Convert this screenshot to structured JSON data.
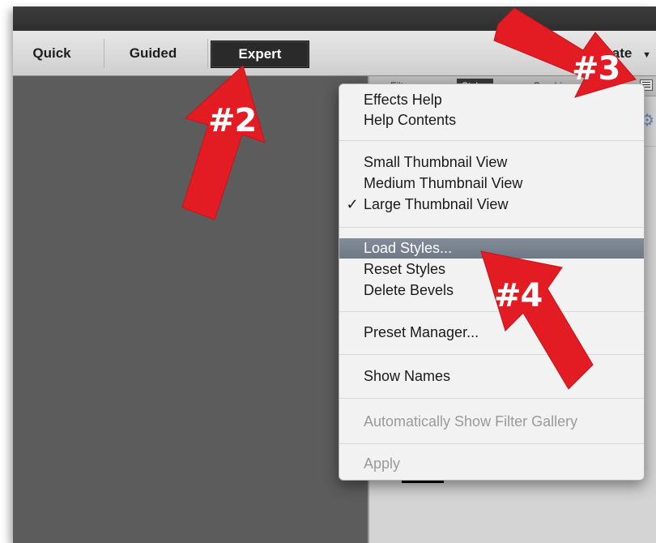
{
  "mode_tabs": {
    "quick": "Quick",
    "guided": "Guided",
    "expert": "Expert"
  },
  "create_menu": {
    "label": "Create"
  },
  "panel": {
    "tabs": [
      "Filters",
      "Styles",
      "Graphics"
    ],
    "menu_icon": "panel-menu-icon",
    "settings_icon": "gear-icon"
  },
  "context_menu": {
    "items": [
      {
        "label": "Effects Help"
      },
      {
        "label": "Help Contents"
      },
      {
        "label": "Small Thumbnail View"
      },
      {
        "label": "Medium Thumbnail View"
      },
      {
        "label": "Large Thumbnail View",
        "checked": true
      },
      {
        "label": "Load Styles...",
        "highlighted": true
      },
      {
        "label": "Reset Styles"
      },
      {
        "label": "Delete Bevels"
      },
      {
        "label": "Preset Manager..."
      },
      {
        "label": "Show Names"
      },
      {
        "label": "Automatically Show Filter Gallery",
        "disabled": true
      },
      {
        "label": "Apply",
        "disabled": true
      }
    ],
    "check_mark": "✓"
  },
  "annotations": [
    {
      "label": "#2",
      "color": "#e31b23"
    },
    {
      "label": "#3",
      "color": "#e31b23"
    },
    {
      "label": "#4",
      "color": "#e31b23"
    }
  ]
}
